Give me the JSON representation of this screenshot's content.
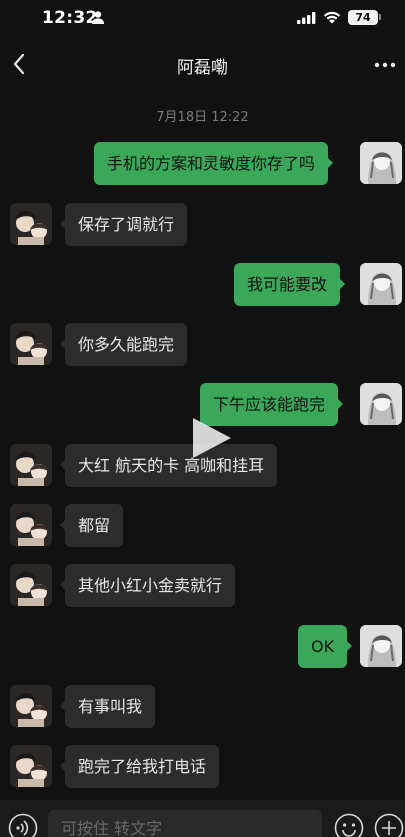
{
  "status": {
    "time": "12:32",
    "battery": "74"
  },
  "header": {
    "title": "阿磊嘞"
  },
  "timestamp": "7月18日 12:22",
  "messages": [
    {
      "side": "right",
      "text": "手机的方案和灵敏度你存了吗"
    },
    {
      "side": "left",
      "text": "保存了调就行"
    },
    {
      "side": "right",
      "text": "我可能要改"
    },
    {
      "side": "left",
      "text": "你多久能跑完"
    },
    {
      "side": "right",
      "text": "下午应该能跑完"
    },
    {
      "side": "left",
      "text": "大红 航天的卡 高咖和挂耳"
    },
    {
      "side": "left",
      "text": "都留"
    },
    {
      "side": "left",
      "text": "其他小红小金卖就行"
    },
    {
      "side": "right",
      "text": "OK"
    },
    {
      "side": "left",
      "text": "有事叫我"
    },
    {
      "side": "left",
      "text": "跑完了给我打电话"
    }
  ],
  "input": {
    "placeholder": "可按住 转文字"
  },
  "colors": {
    "bubble_self": "#3aa759",
    "bubble_other": "#2c2c2c",
    "background": "#111111"
  },
  "icons": [
    "back-icon",
    "more-icon",
    "person-icon",
    "signal-icon",
    "wifi-icon",
    "play-icon",
    "voice-icon",
    "emoji-icon",
    "plus-icon"
  ]
}
